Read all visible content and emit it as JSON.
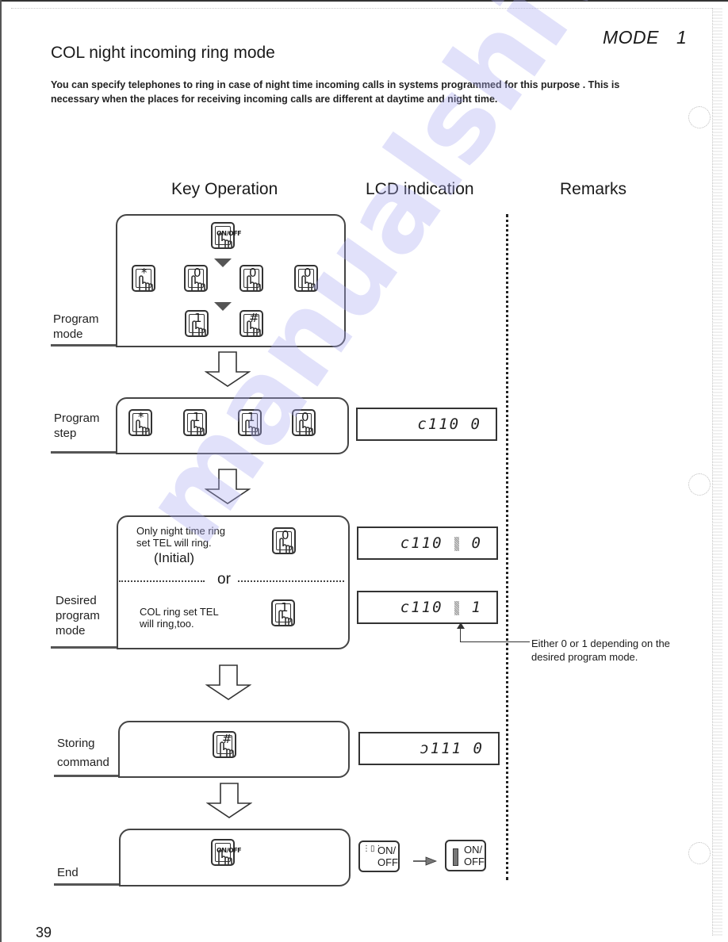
{
  "header": {
    "mode_word": "MODE",
    "mode_number": "1",
    "title": "COL night incoming ring mode",
    "intro": "You can specify telephones to ring in case of night time incoming calls in systems programmed for this purpose . This is necessary when the places for receiving incoming calls are different at daytime and night time."
  },
  "columns": {
    "key_operation": "Key Operation",
    "lcd_indication": "LCD indication",
    "remarks": "Remarks"
  },
  "steps": {
    "program_mode": {
      "label_line1": "Program",
      "label_line2": "mode",
      "keys": {
        "onoff": "ON/OFF",
        "star": "*",
        "zero": "0",
        "one": "1",
        "hash": "#"
      }
    },
    "program_step": {
      "label_line1": "Program",
      "label_line2": "step",
      "keys": [
        "*",
        "1",
        "1",
        "0"
      ],
      "lcd": "c110 0"
    },
    "desired_mode": {
      "label_line1": "Desired",
      "label_line2": "program",
      "label_line3": "mode",
      "option_a_line1": "Only night time ring",
      "option_a_line2": "set TEL will ring.",
      "option_a_note": "(Initial)",
      "option_a_key": "0",
      "or_label": "or",
      "option_b_line1": "COL ring set TEL",
      "option_b_line2": "will ring,too.",
      "option_b_key": "1",
      "lcd_a_prefix": "c110",
      "lcd_a_value": "0",
      "lcd_b_prefix": "c110",
      "lcd_b_value": "1",
      "remark_line1": "Either 0 or 1 depending on the",
      "remark_line2": "desired program mode."
    },
    "storing": {
      "label_line1": "Storing",
      "label_line2": "command",
      "key": "#",
      "lcd": "ɔ111 0"
    },
    "end": {
      "label": "End",
      "key": "ON/OFF",
      "indicator_before_line1": "ON/",
      "indicator_before_line2": "OFF",
      "indicator_after_line1": "ON/",
      "indicator_after_line2": "OFF"
    }
  },
  "footer": {
    "page_number": "39"
  },
  "watermark": "manualshive.com",
  "colors": {
    "ink": "#1a1a1a",
    "watermark": "#aaaaf0"
  }
}
